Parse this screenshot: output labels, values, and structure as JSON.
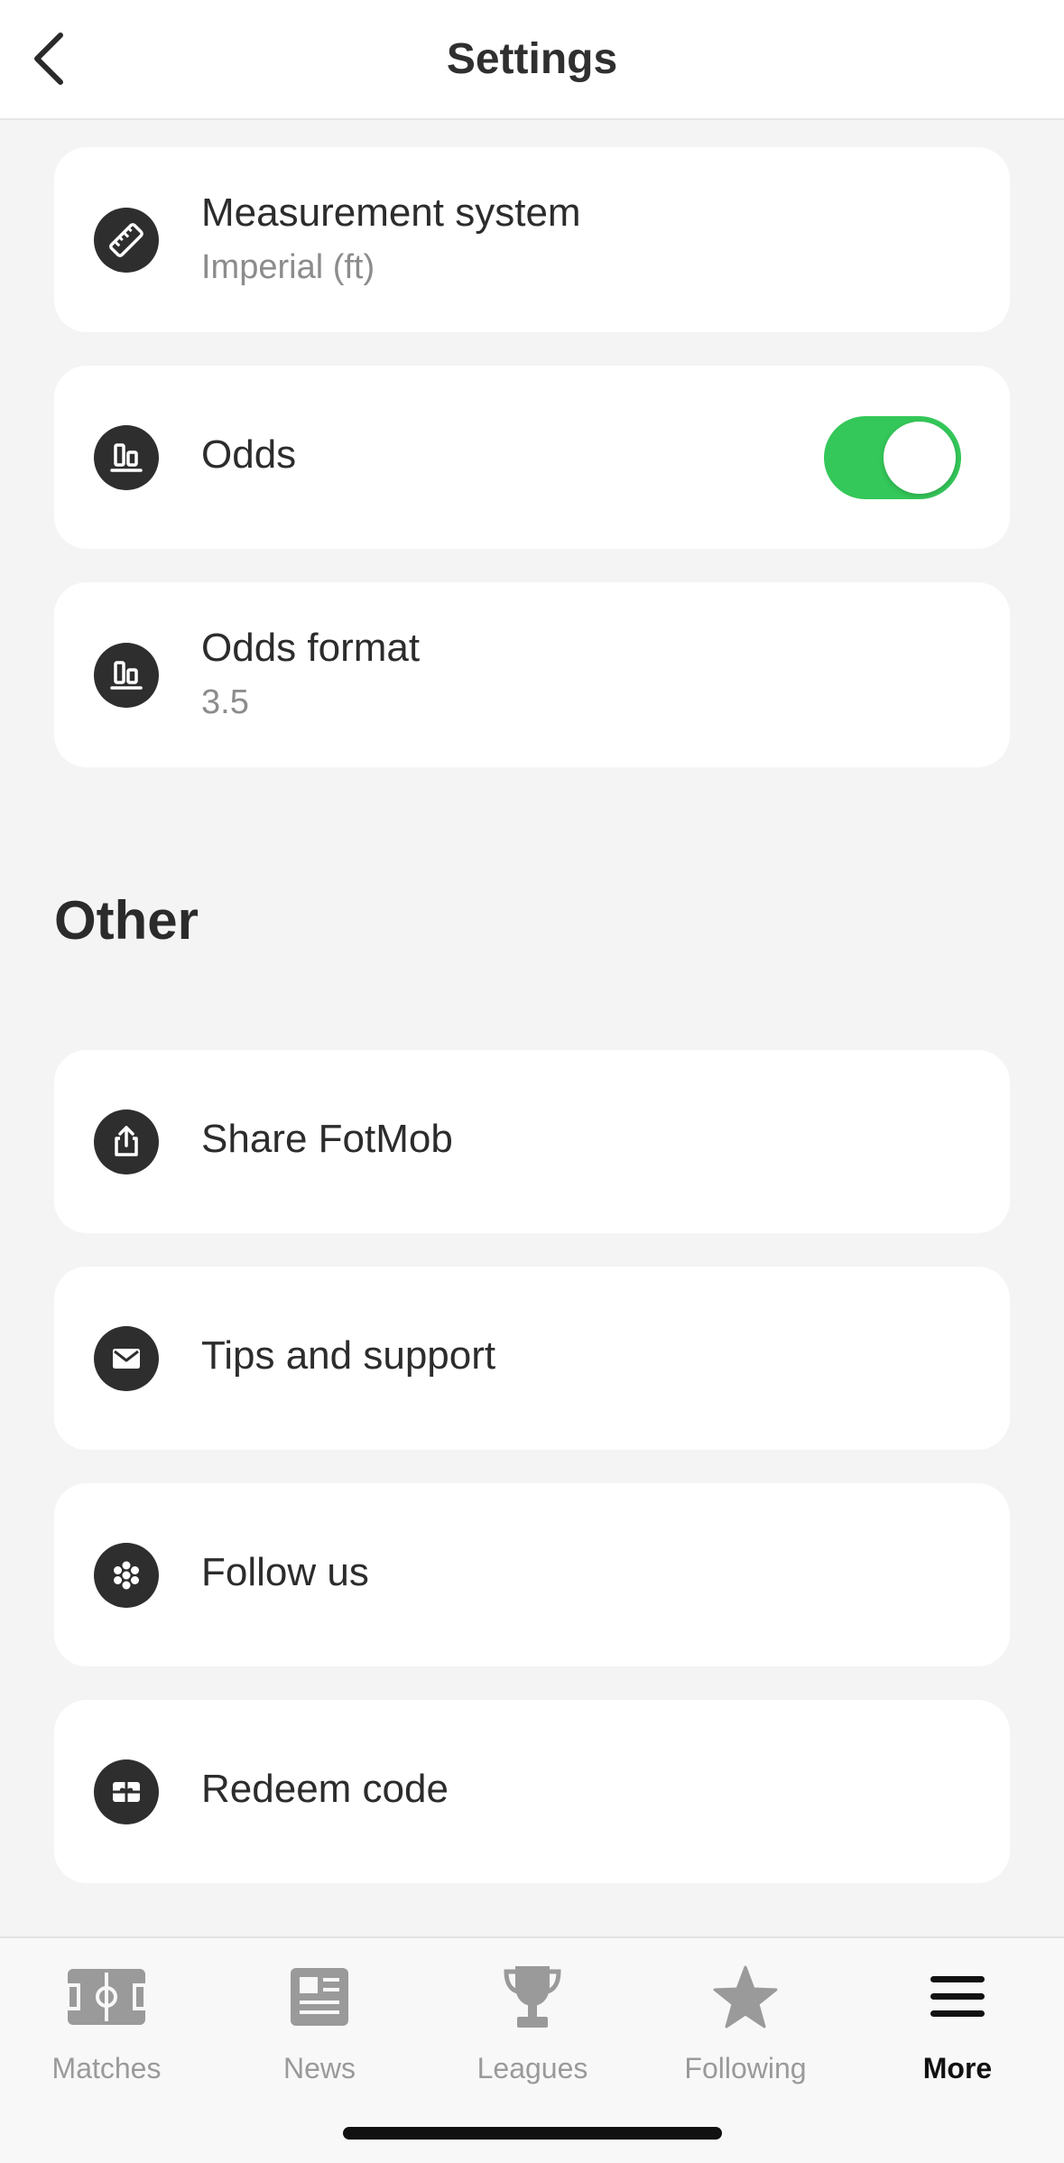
{
  "header": {
    "title": "Settings"
  },
  "settings": {
    "measurement": {
      "label": "Measurement system",
      "value": "Imperial (ft)",
      "icon": "ruler-icon"
    },
    "odds": {
      "label": "Odds",
      "toggle_on": true,
      "icon": "odds-icon"
    },
    "odds_format": {
      "label": "Odds format",
      "value": "3.5",
      "icon": "odds-icon"
    }
  },
  "other": {
    "title": "Other",
    "items": [
      {
        "label": "Share FotMob",
        "icon": "share-icon"
      },
      {
        "label": "Tips and support",
        "icon": "mail-icon"
      },
      {
        "label": "Follow us",
        "icon": "social-icon"
      },
      {
        "label": "Redeem code",
        "icon": "gift-icon"
      }
    ]
  },
  "tabbar": {
    "tabs": [
      {
        "label": "Matches",
        "icon": "pitch-icon",
        "active": false
      },
      {
        "label": "News",
        "icon": "news-icon",
        "active": false
      },
      {
        "label": "Leagues",
        "icon": "trophy-icon",
        "active": false
      },
      {
        "label": "Following",
        "icon": "star-icon",
        "active": false
      },
      {
        "label": "More",
        "icon": "menu-icon",
        "active": true
      }
    ]
  },
  "colors": {
    "toggle_on": "#34c759",
    "icon_bg": "#2e2e2e",
    "tab_inactive": "#9a9a9a",
    "tab_active": "#111111"
  }
}
